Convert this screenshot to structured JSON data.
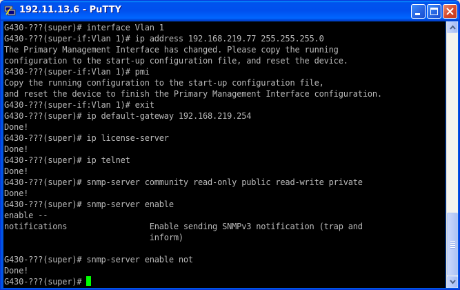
{
  "window": {
    "title": "192.11.13.6 - PuTTY",
    "app_icon": "putty-icon",
    "controls": {
      "minimize_icon": "minimize-icon",
      "maximize_icon": "maximize-icon",
      "close_icon": "close-icon"
    }
  },
  "terminal": {
    "text_color": "#bbbbbb",
    "background": "#000000",
    "cursor_color": "#00ff00",
    "lines": [
      "G430-???(super)# interface Vlan 1",
      "G430-???(super-if:Vlan 1)# ip address 192.168.219.77 255.255.255.0",
      "The Primary Management Interface has changed. Please copy the running",
      "configuration to the start-up configuration file, and reset the device.",
      "G430-???(super-if:Vlan 1)# pmi",
      "Copy the running configuration to the start-up configuration file,",
      "and reset the device to finish the Primary Management Interface configuration.",
      "G430-???(super-if:Vlan 1)# exit",
      "G430-???(super)# ip default-gateway 192.168.219.254",
      "Done!",
      "G430-???(super)# ip license-server",
      "Done!",
      "G430-???(super)# ip telnet",
      "Done!",
      "G430-???(super)# snmp-server community read-only public read-write private",
      "Done!",
      "G430-???(super)# snmp-server enable",
      "enable --",
      "notifications                 Enable sending SNMPv3 notification (trap and",
      "                              inform)",
      "",
      "G430-???(super)# snmp-server enable not",
      "Done!"
    ],
    "prompt": "G430-???(super)# "
  },
  "scrollbar": {
    "up_icon": "scroll-up-arrow-icon",
    "down_icon": "scroll-down-arrow-icon"
  }
}
